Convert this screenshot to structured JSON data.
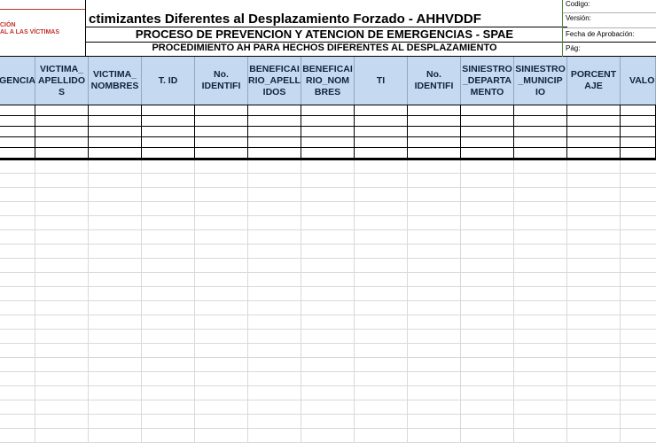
{
  "header": {
    "logo_lines": [
      "CIÓN",
      "AL A LAS VÍCTIMAS"
    ],
    "title": "ctimizantes Diferentes al Desplazamiento Forzado - AHHVDDF",
    "process": "PROCESO DE PREVENCION Y ATENCION DE EMERGENCIAS - SPAE",
    "procedure": "PROCEDIMIENTO AH PARA HECHOS DIFERENTES AL DESPLAZAMIENTO",
    "meta": {
      "codigo": "Codigo:",
      "version": "Versión:",
      "fecha": "Fecha de Aprobación:",
      "pag": "Pág:"
    }
  },
  "columns": [
    "GENCIA",
    "VICTIMA_\nAPELLIDO\nS",
    "VICTIMA_\nNOMBRES",
    "T. ID",
    "No.\nIDENTIFI",
    "BENEFICAI\nRIO_APELL\nIDOS",
    "BENEFICAI\nRIO_NOM\nBRES",
    "TI",
    "No.\nIDENTIFI",
    "SINIESTRO\n_DEPARTA\nMENTO",
    "SINIESTRO\n_MUNICIP\nIO",
    "PORCENT\nAJE",
    "VALO"
  ],
  "colors": {
    "header_fill": "#c5d9f1",
    "brand_red": "#c0312b",
    "grid": "#d9d9d9"
  }
}
